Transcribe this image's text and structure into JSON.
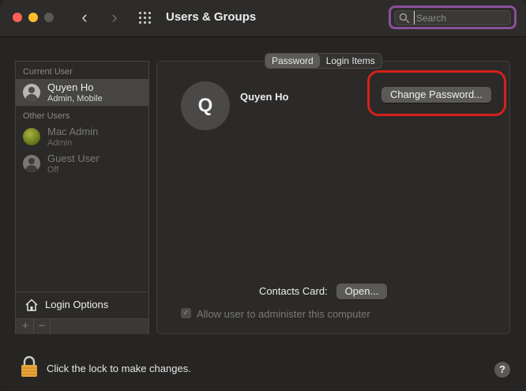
{
  "window": {
    "title": "Users & Groups"
  },
  "search": {
    "placeholder": "Search",
    "value": ""
  },
  "sidebar": {
    "current_user_header": "Current User",
    "other_users_header": "Other Users",
    "users": [
      {
        "name": "Quyen Ho",
        "subtitle": "Admin, Mobile",
        "selected": true
      },
      {
        "name": "Mac Admin",
        "subtitle": "Admin",
        "selected": false
      },
      {
        "name": "Guest User",
        "subtitle": "Off",
        "selected": false
      }
    ],
    "login_options_label": "Login Options",
    "add_label": "+",
    "remove_label": "−"
  },
  "tabs": [
    {
      "label": "Password",
      "active": true
    },
    {
      "label": "Login Items",
      "active": false
    }
  ],
  "main": {
    "avatar_initial": "Q",
    "user_name": "Quyen Ho",
    "change_password_label": "Change Password...",
    "contacts_card_label": "Contacts Card:",
    "open_label": "Open...",
    "admin_checkbox_label": "Allow user to administer this computer",
    "admin_checked": true
  },
  "footer": {
    "lock_label": "Click the lock to make changes.",
    "help_label": "?"
  },
  "colors": {
    "highlight_red": "#d4211a",
    "search_focus_purple": "#8b4f9b",
    "lock_gold": "#e8a33a"
  }
}
